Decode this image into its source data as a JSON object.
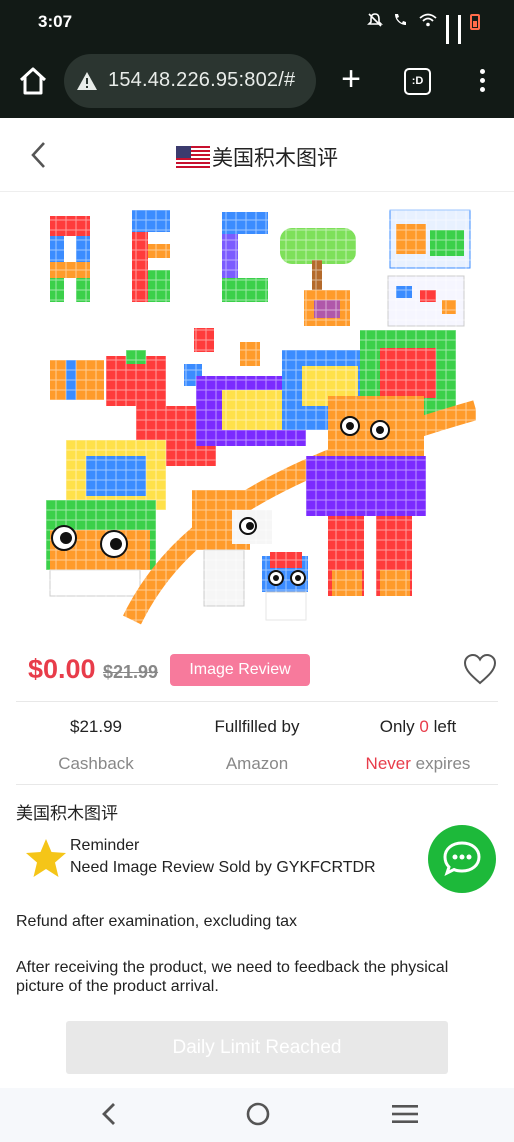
{
  "status_bar": {
    "time": "3:07"
  },
  "browser": {
    "url": "154.48.226.95:802/#",
    "tabs_label": ":D"
  },
  "header": {
    "title": "美国积木图评"
  },
  "product": {
    "price": "$0.00",
    "original_price": "$21.99",
    "review_button_label": "Image Review"
  },
  "stats": [
    {
      "value": "$21.99",
      "label": "Cashback"
    },
    {
      "value": "Fullfilled by",
      "label": "Amazon"
    },
    {
      "value_prefix": "Only ",
      "value_count": "0",
      "value_suffix": " left",
      "label_highlight": "Never",
      "label_rest": " expires"
    }
  ],
  "section_title": "美国积木图评",
  "reminder": {
    "title": "Reminder",
    "text": "Need Image Review Sold by GYKFCRTDR"
  },
  "refund_note": "Refund after examination, excluding tax",
  "feedback_note": "After receiving the product, we need to feedback the physical picture of the product arrival.",
  "action_button_label": "Daily Limit Reached",
  "colors": {
    "price_red": "#e83c4a",
    "review_pink": "#f77a9c",
    "chat_green": "#1db93a",
    "star_yellow": "#f5c518"
  },
  "icons": [
    "home-icon",
    "warning-icon",
    "plus-icon",
    "tabs-icon",
    "more-icon",
    "back-arrow-icon",
    "us-flag-icon",
    "heart-icon",
    "star-icon",
    "chat-icon"
  ]
}
